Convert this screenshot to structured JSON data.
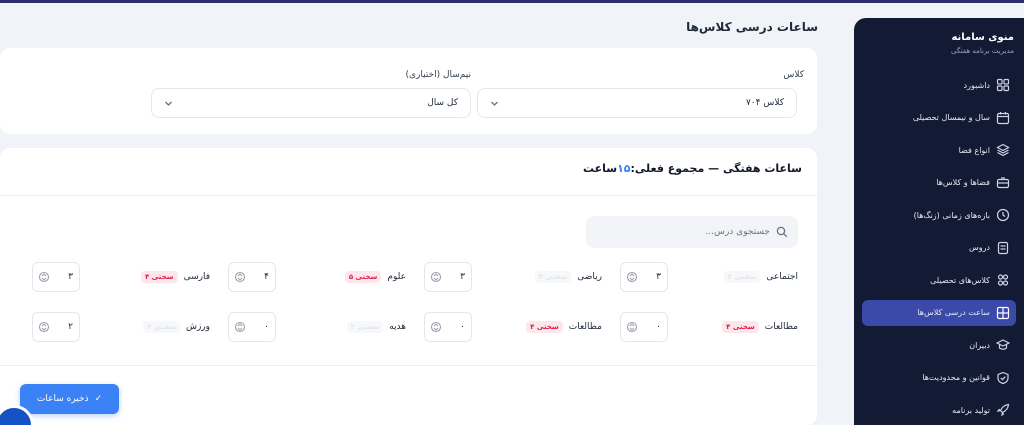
{
  "sidebar": {
    "brand_title": "منوی سامانه",
    "brand_subtitle": "مدیریت برنامه هفتگی",
    "items": [
      {
        "label": "داشبورد",
        "icon": "dashboard-icon"
      },
      {
        "label": "سال و نیمسال تحصیلی",
        "icon": "calendar-icon"
      },
      {
        "label": "انواع فضا",
        "icon": "layers-icon"
      },
      {
        "label": "فضاها و کلاس‌ها",
        "icon": "classroom-icon"
      },
      {
        "label": "بازه‌های زمانی (زنگ‌ها)",
        "icon": "clock-icon"
      },
      {
        "label": "دروس",
        "icon": "book-icon"
      },
      {
        "label": "کلاس‌های تحصیلی",
        "icon": "users-icon"
      },
      {
        "label": "ساعت درسی کلاس‌ها",
        "icon": "grid-icon"
      },
      {
        "label": "دبیران",
        "icon": "graduation-icon"
      },
      {
        "label": "قوانین و محدودیت‌ها",
        "icon": "shield-icon"
      },
      {
        "label": "تولید برنامه",
        "icon": "rocket-icon"
      }
    ],
    "active_index": 7
  },
  "page": {
    "title": "ساعات درسی کلاس‌ها"
  },
  "filters": {
    "class_label": "کلاس",
    "class_value": "کلاس ۷۰۴",
    "semester_label": "نیم‌سال (اختیاری)",
    "semester_value": "کل سال"
  },
  "hours": {
    "title_prefix": "ساعات هفتگی — مجموع فعلی:",
    "total": "۱۵",
    "title_suffix": "ساعت",
    "search_placeholder": "جستجوی درس...",
    "subjects": [
      {
        "name": "اجتماعی",
        "badge": "سختی ۳",
        "badge_style": "faded",
        "value": "۳"
      },
      {
        "name": "ریاضی",
        "badge": "سختی ۳",
        "badge_style": "faded",
        "value": "۳"
      },
      {
        "name": "علوم",
        "badge": "سختی ۵",
        "badge_style": "hard",
        "value": "۴"
      },
      {
        "name": "فارسی",
        "badge": "سختی ۴",
        "badge_style": "hard",
        "value": "۳"
      },
      {
        "name": "مطالعات",
        "badge": "سختی ۴",
        "badge_style": "hard",
        "value": "۰"
      },
      {
        "name": "مطالعات",
        "badge": "سختی ۴",
        "badge_style": "hard",
        "value": "۰"
      },
      {
        "name": "هدیه",
        "badge": "سختی ۲",
        "badge_style": "faded",
        "value": "۰"
      },
      {
        "name": "ورزش",
        "badge": "سختی ۲",
        "badge_style": "faded",
        "value": "۲"
      }
    ]
  },
  "actions": {
    "save_label": "ذخیره ساعات"
  },
  "colors": {
    "sidebar_bg": "#131a33",
    "active_item": "#3b4aa8",
    "primary": "#3b82f6",
    "hard_badge": "#e11d48"
  }
}
